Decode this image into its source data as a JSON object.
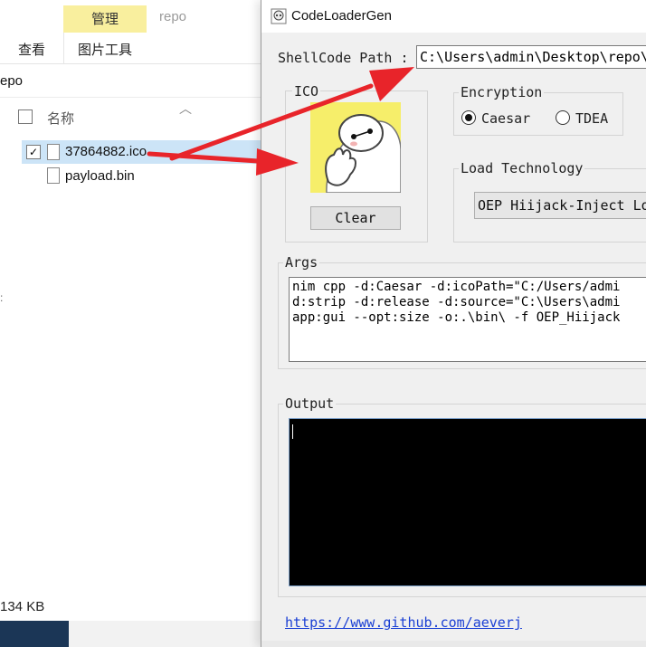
{
  "explorer": {
    "manage_tab": "管理",
    "window_title": "repo",
    "ribbon_tabs": [
      "查看",
      "图片工具"
    ],
    "address": "epo",
    "column_header": "名称",
    "files": [
      {
        "name": "37864882.ico",
        "selected": true
      },
      {
        "name": "payload.bin",
        "selected": false
      }
    ],
    "status_size": "134 KB",
    "colors": {
      "manage_tab_bg": "#f9ef9e",
      "selection_bg": "#cce4f7"
    }
  },
  "app": {
    "title": "CodeLoaderGen",
    "shellcode_label": "ShellCode Path :",
    "shellcode_path": "C:\\Users\\admin\\Desktop\\repo\\",
    "ico_label": "ICO",
    "clear_button": "Clear",
    "encryption_label": "Encryption",
    "encryption_options": [
      {
        "label": "Caesar",
        "selected": true
      },
      {
        "label": "TDEA",
        "selected": false
      }
    ],
    "load_label": "Load Technology",
    "load_value": "OEP Hiijack-Inject Lo",
    "args_label": "Args",
    "args_lines": [
      "nim cpp -d:Caesar -d:icoPath=\"C:/Users/admi",
      "d:strip -d:release -d:source=\"C:\\Users\\admi",
      "app:gui --opt:size -o:.\\bin\\ -f OEP_Hiijack"
    ],
    "output_label": "Output",
    "link": "https://www.github.com/aeverj",
    "colors": {
      "output_bg": "#000000",
      "link": "#1a3fd4",
      "window_bg": "#f0f0f0"
    }
  },
  "annotations": {
    "arrow_color": "#e8242a"
  }
}
